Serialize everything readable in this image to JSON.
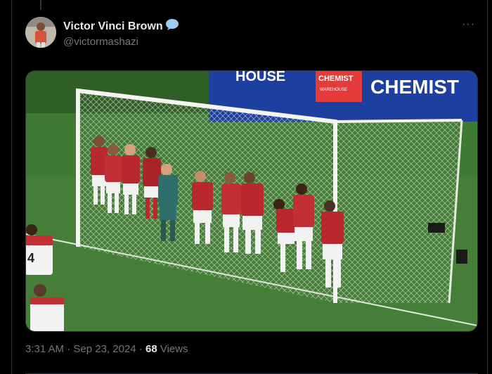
{
  "tweet": {
    "display_name": "Victor Vinci Brown",
    "handle": "@victormashazi",
    "verified_icon": "speech-bubble-emoji",
    "more_icon": "ellipsis-icon",
    "more_label": "···",
    "time": "3:31 AM",
    "separator": " · ",
    "date": "Sep 23, 2024",
    "views_count": "68",
    "views_label": " Views"
  },
  "media": {
    "board_text_1": "CHEMIST",
    "board_text_2": "CHEMIST",
    "board_text_3": "WAREHOUSE",
    "board_text_4": "HOUSE",
    "colors": {
      "pitch": "#3f7a33",
      "shirt_red": "#b8282e",
      "shorts_white": "#f2f2f2",
      "keeper_teal": "#2e6f6b",
      "board_blue": "#1d3fa0"
    }
  }
}
